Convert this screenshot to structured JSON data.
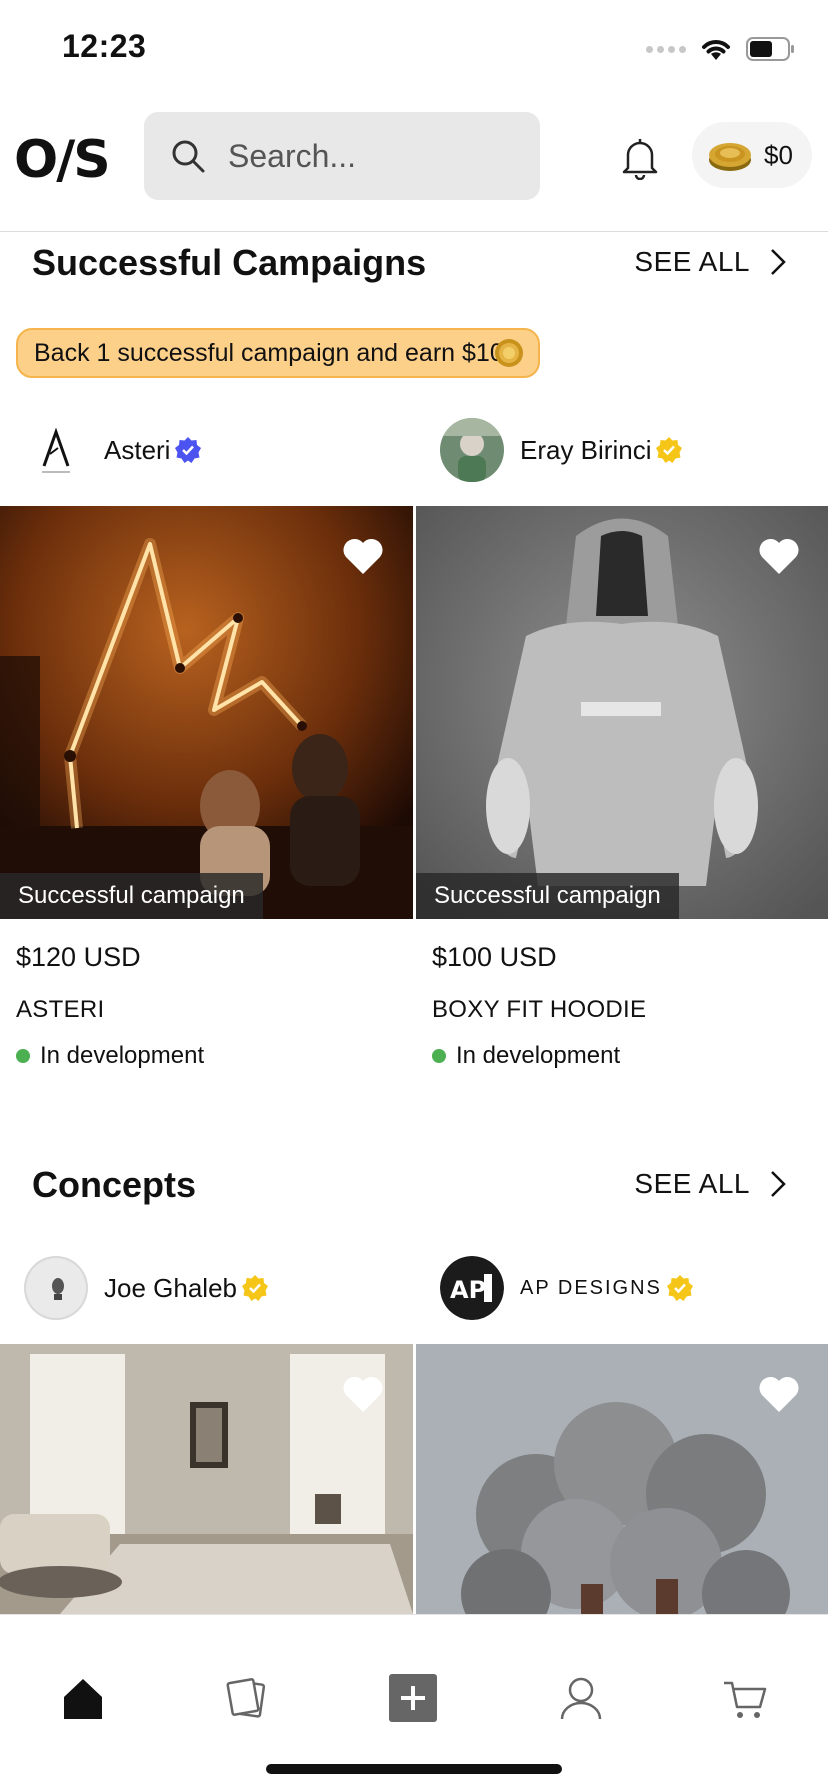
{
  "status_bar": {
    "time": "12:23"
  },
  "header": {
    "logo": "O/S",
    "search_placeholder": "Search...",
    "balance": "$0"
  },
  "successful": {
    "title": "Successful Campaigns",
    "see_all": "SEE ALL",
    "promo": "Back 1 successful campaign and earn $10!",
    "items": [
      {
        "creator": "Asteri",
        "badge": "blue",
        "tag": "Successful campaign",
        "price": "$120 USD",
        "name": "ASTERI",
        "status": "In development"
      },
      {
        "creator": "Eray Birinci",
        "badge": "gold",
        "tag": "Successful campaign",
        "price": "$100 USD",
        "name": "BOXY FIT HOODIE",
        "status": "In development"
      }
    ]
  },
  "concepts": {
    "title": "Concepts",
    "see_all": "SEE ALL",
    "items": [
      {
        "creator": "Joe Ghaleb",
        "badge": "gold"
      },
      {
        "creator": "AP DESIGNS",
        "badge": "gold"
      }
    ]
  },
  "colors": {
    "promo_bg": "#fdd08a",
    "status_dot": "#4caf50",
    "verified_blue": "#4b54f0",
    "verified_gold": "#f5c518"
  },
  "nav": {
    "items": [
      "home-icon",
      "cards-icon",
      "create-icon",
      "profile-icon",
      "cart-icon"
    ],
    "active": "home-icon"
  }
}
